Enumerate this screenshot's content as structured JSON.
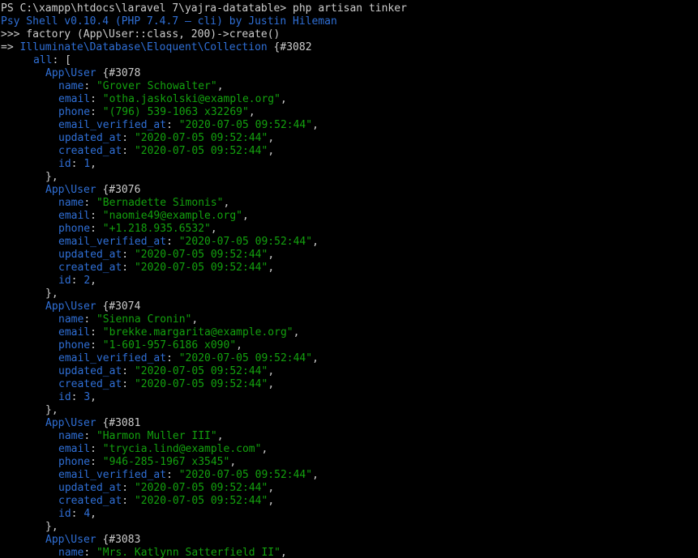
{
  "colors": {
    "background": "#000000",
    "text": "#cccccc",
    "blue": "#2f6fd6",
    "green": "#13a10e"
  },
  "header": {
    "prompt_line": "PS C:\\xampp\\htdocs\\laravel 7\\yajra-datatable> php artisan tinker",
    "psy_line": "Psy Shell v0.10.4 (PHP 7.4.7 — cli) by Justin Hileman",
    "input_line": ">>> factory (App\\User::class, 200)->create()",
    "result_arrow": "=> ",
    "collection_class": "Illuminate\\Database\\Eloquent\\Collection",
    "collection_id": " {#3082",
    "all_label": "all",
    "all_open": ": ["
  },
  "labels": {
    "class_name": "App\\User",
    "name": "name",
    "email": "email",
    "phone": "phone",
    "email_verified_at": "email_verified_at",
    "updated_at": "updated_at",
    "created_at": "created_at",
    "id": "id",
    "close": "},"
  },
  "users": [
    {
      "ref": " {#3078",
      "name": "\"Grover Schowalter\"",
      "email": "\"otha.jaskolski@example.org\"",
      "phone": "\"(796) 539-1063 x32269\"",
      "email_verified_at": "\"2020-07-05 09:52:44\"",
      "updated_at": "\"2020-07-05 09:52:44\"",
      "created_at": "\"2020-07-05 09:52:44\"",
      "id": "1"
    },
    {
      "ref": " {#3076",
      "name": "\"Bernadette Simonis\"",
      "email": "\"naomie49@example.org\"",
      "phone": "\"+1.218.935.6532\"",
      "email_verified_at": "\"2020-07-05 09:52:44\"",
      "updated_at": "\"2020-07-05 09:52:44\"",
      "created_at": "\"2020-07-05 09:52:44\"",
      "id": "2"
    },
    {
      "ref": " {#3074",
      "name": "\"Sienna Cronin\"",
      "email": "\"brekke.margarita@example.org\"",
      "phone": "\"1-601-957-6186 x090\"",
      "email_verified_at": "\"2020-07-05 09:52:44\"",
      "updated_at": "\"2020-07-05 09:52:44\"",
      "created_at": "\"2020-07-05 09:52:44\"",
      "id": "3"
    },
    {
      "ref": " {#3081",
      "name": "\"Harmon Muller III\"",
      "email": "\"trycia.lind@example.com\"",
      "phone": "\"946-285-1967 x3545\"",
      "email_verified_at": "\"2020-07-05 09:52:44\"",
      "updated_at": "\"2020-07-05 09:52:44\"",
      "created_at": "\"2020-07-05 09:52:44\"",
      "id": "4"
    }
  ],
  "last_user": {
    "ref": " {#3083",
    "name": "\"Mrs. Katlynn Satterfield II\""
  }
}
